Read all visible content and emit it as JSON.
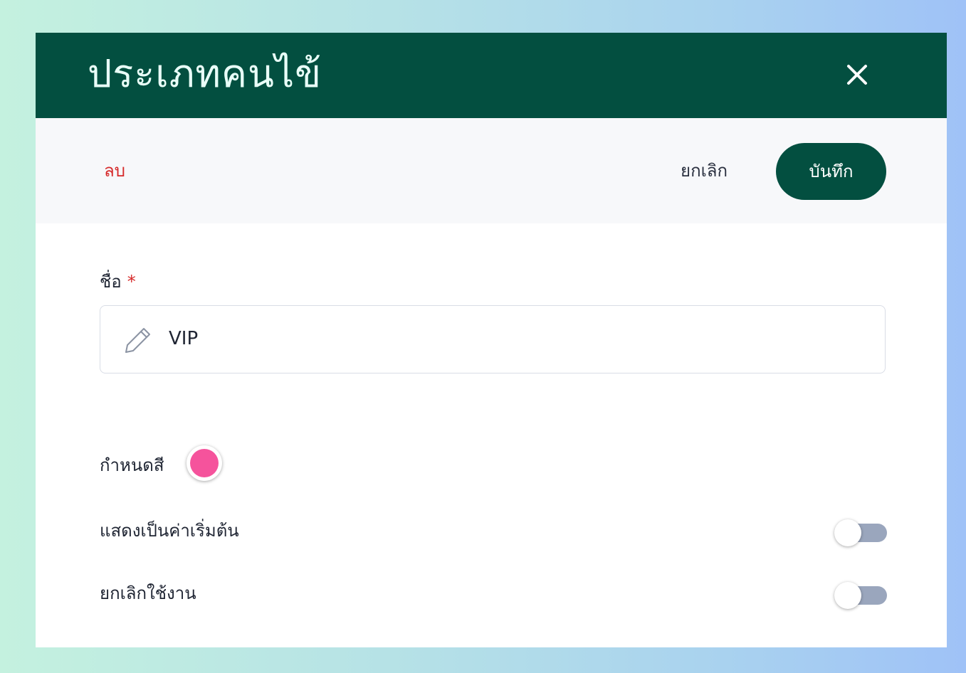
{
  "modal": {
    "title": "ประเภทคนไข้",
    "close_label": "×"
  },
  "toolbar": {
    "delete_label": "ลบ",
    "cancel_label": "ยกเลิก",
    "save_label": "บันทึก"
  },
  "form": {
    "name_label": "ชื่อ",
    "required_mark": "*",
    "name_value": "VIP",
    "color_label": "กำหนดสี",
    "color_value": "#f5539c",
    "default_label": "แสดงเป็นค่าเริ่มต้น",
    "default_on": false,
    "disable_label": "ยกเลิกใช้งาน",
    "disable_on": false
  },
  "colors": {
    "header": "#034f40",
    "danger": "#d62a2a",
    "toggle_track": "#9aa6bd"
  }
}
